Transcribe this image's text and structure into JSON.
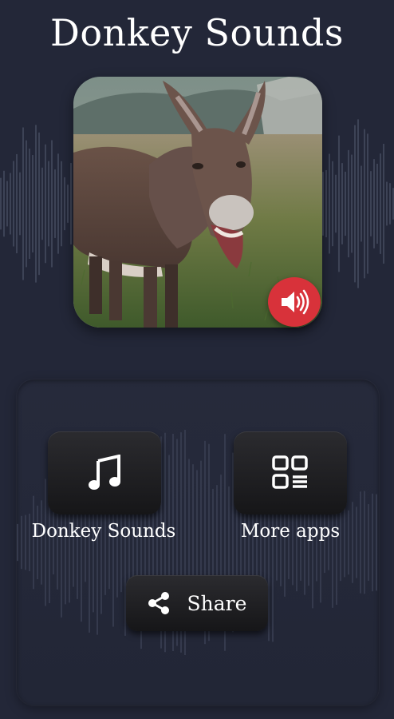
{
  "app": {
    "title": "Donkey Sounds"
  },
  "hero": {
    "image_subject": "laughing donkey in a grassy field",
    "sound_icon": "speaker-volume-icon",
    "sound_button_color": "#d8323a"
  },
  "menu": {
    "items": [
      {
        "label": "Donkey Sounds",
        "icon": "music-note-icon"
      },
      {
        "label": "More apps",
        "icon": "grid-apps-icon"
      }
    ],
    "share": {
      "label": "Share",
      "icon": "share-icon"
    }
  },
  "colors": {
    "background": "#232738",
    "tile": "#1e1e21",
    "accent": "#d8323a"
  }
}
